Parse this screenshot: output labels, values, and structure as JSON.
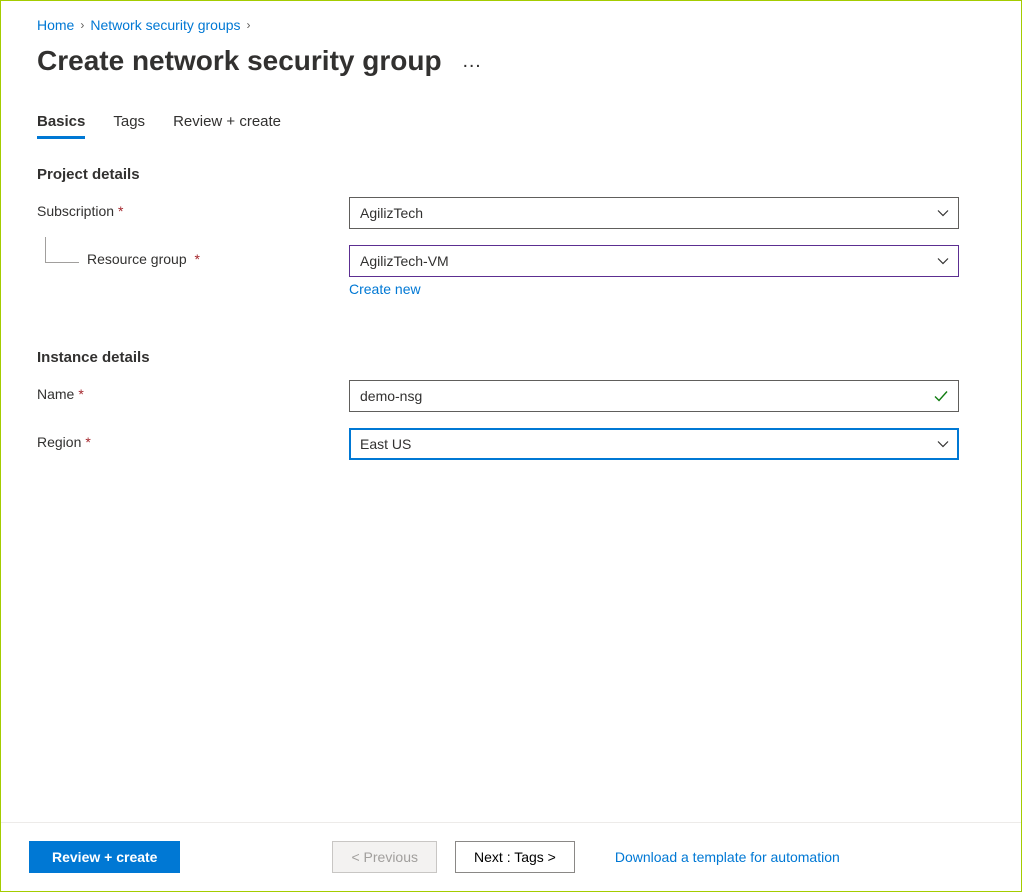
{
  "breadcrumb": {
    "home": "Home",
    "nsg": "Network security groups"
  },
  "page_title": "Create network security group",
  "tabs": {
    "basics": "Basics",
    "tags": "Tags",
    "review": "Review + create"
  },
  "project_details": {
    "heading": "Project details",
    "subscription_label": "Subscription",
    "subscription_value": "AgilizTech",
    "resource_group_label": "Resource group",
    "resource_group_value": "AgilizTech-VM",
    "create_new": "Create new"
  },
  "instance_details": {
    "heading": "Instance details",
    "name_label": "Name",
    "name_value": "demo-nsg",
    "region_label": "Region",
    "region_value": "East US"
  },
  "footer": {
    "review_create": "Review + create",
    "previous": "< Previous",
    "next": "Next : Tags >",
    "download_template": "Download a template for automation"
  }
}
